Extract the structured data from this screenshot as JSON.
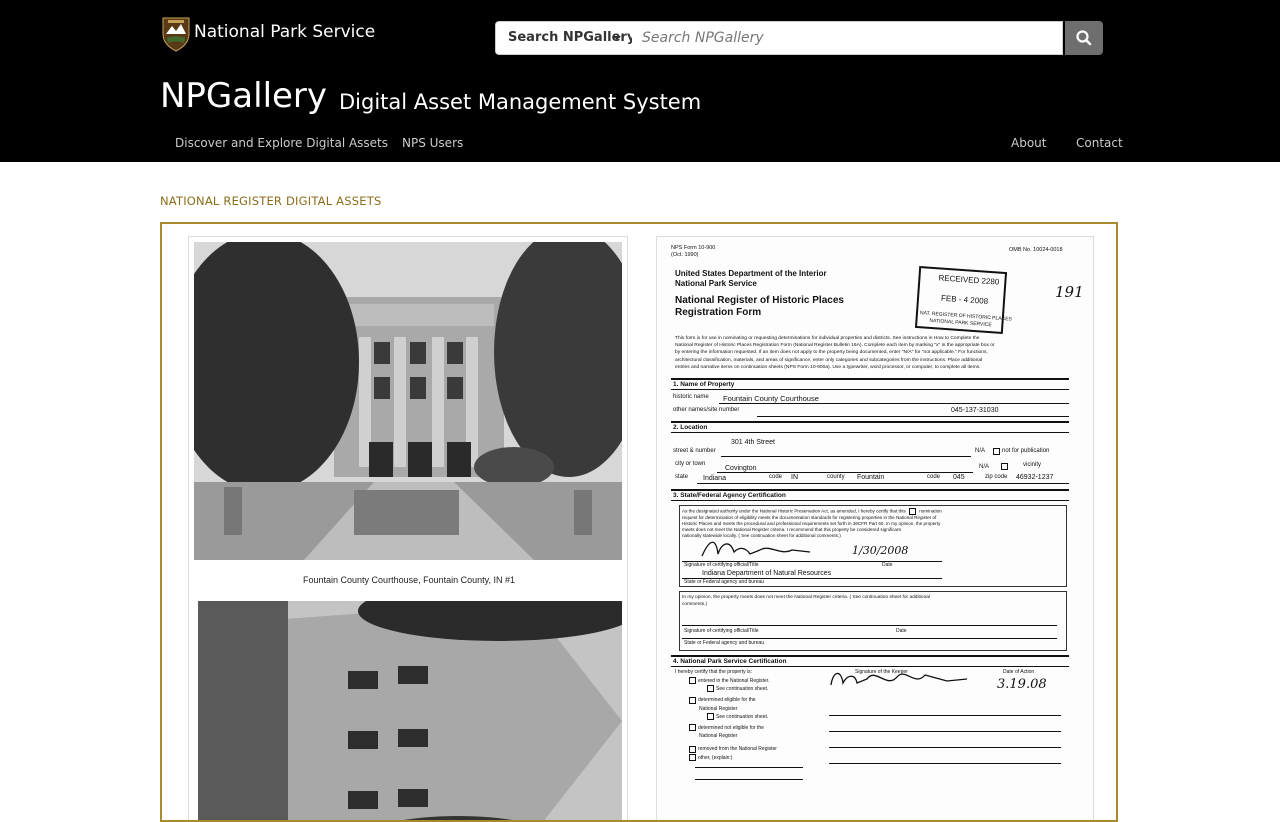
{
  "header": {
    "agency_name": "National Park Service",
    "logo_icon": "nps-arrowhead-icon",
    "title": "NPGallery",
    "subtitle": "Digital Asset Management System"
  },
  "search": {
    "scope_label": "Search NPGallery",
    "placeholder": "Search NPGallery",
    "button_icon": "search-icon"
  },
  "nav": {
    "left": [
      "Discover and Explore Digital Assets",
      "NPS Users"
    ],
    "right": [
      "About",
      "Contact"
    ]
  },
  "section_heading": "NATIONAL REGISTER DIGITAL ASSETS",
  "colors": {
    "accent": "#8a6d1b",
    "frame_border": "#a88a2f",
    "header_bg": "#000000"
  },
  "photo_page": {
    "caption": "Fountain County Courthouse, Fountain County, IN #1"
  },
  "document": {
    "form_no": "NPS Form 10-900",
    "form_date": "(Oct. 1990)",
    "omb": "OMB No. 10024-0018",
    "dept_line1": "United States Department of the Interior",
    "dept_line2": "National Park Service",
    "form_title1": "National Register of Historic Places",
    "form_title2": "Registration Form",
    "stamp_line1": "RECEIVED 2280",
    "stamp_line2": "FEB - 4 2008",
    "stamp_line3": "NAT. REGISTER OF HISTORIC PLACES",
    "stamp_line4": "NATIONAL PARK SERVICE",
    "handwritten_number": "191",
    "intro": [
      "This form is for use in nominating or requesting determinations for individual properties and districts.  See instructions in How to Complete the",
      "National Register of Historic Places Registration Form  (National Register Bulletin 16A).  Complete each item by marking \"x\" in the appropriate box or",
      "by entering the information requested.  If an item does not apply to the property being documented, enter \"N/A\" for \"not applicable.\"  For functions,",
      "architectural classification, materials, and areas of significance, enter only categories and subcategories from the instructions.  Place additional",
      "entries and narrative items on continuation sheets (NPS Form 10-900a).  Use a typewriter, word processor, or computer, to complete all items."
    ],
    "s1_title": "1.  Name of Property",
    "historic_name_label": "historic name",
    "historic_name": "Fountain County Courthouse",
    "other_names_label": "other names/site number",
    "site_number": "045-137-31030",
    "s2_title": "2.  Location",
    "street": "301 4th Street",
    "street_label": "street & number",
    "na1": "N/A",
    "not_for_publication": "not for publication",
    "city_label": "city or town",
    "city": "Covington",
    "na2": "N/A",
    "vicinity": "vicinity",
    "state_label": "state",
    "state": "Indiana",
    "code_label": "code",
    "state_code": "IN",
    "county_label": "county",
    "county": "Fountain",
    "county_code": "045",
    "zip_label": "zip code",
    "zip": "46932-1237",
    "s3_title": "3.  State/Federal Agency Certification",
    "s3_text": [
      "As the designated authority under the National Historic Preservation Act, as amended, I hereby  certify that this",
      "request for determination of eligibility meets the documentation standards for registering properties in the National Register of",
      "Historic Places and meets the procedural and professional requirements set forth in 36CFR Part 60.  In my opinion, the property",
      "meets       does not meet the National Register criteria.  I recommend that this property be considered significant",
      "nationally       statewide       locally.  (      See continuation sheet for additional comments.)"
    ],
    "nomination": "nomination",
    "sig1_label": "Signature of certifying official/Title",
    "date_label": "Date",
    "sig1_date": "1/30/2008",
    "agency1": "Indiana Department of Natural Resources",
    "agency_label": "State or Federal agency and bureau",
    "opinion_text": "In my opinion, the property       meets       does not meet the National Register criteria.  (      See continuation sheet for additional",
    "comments": "comments.)",
    "sig2_label": "Signature of certifying official/Title",
    "agency2_label": "State or Federal agency and bureau",
    "s4_title": "4.  National Park Service Certification",
    "s4_intro": "I hereby certify that the property is:",
    "keeper_label": "Signature of the Keeper",
    "action_label": "Date of Action",
    "action_date": "3.19.08",
    "s4_items": [
      "entered in the National Register.",
      "See continuation sheet.",
      "determined eligible for the",
      "National Register",
      "See continuation sheet.",
      "determined not eligible for the",
      "National Register",
      "removed from the National Register",
      "other, (explain:)"
    ]
  }
}
